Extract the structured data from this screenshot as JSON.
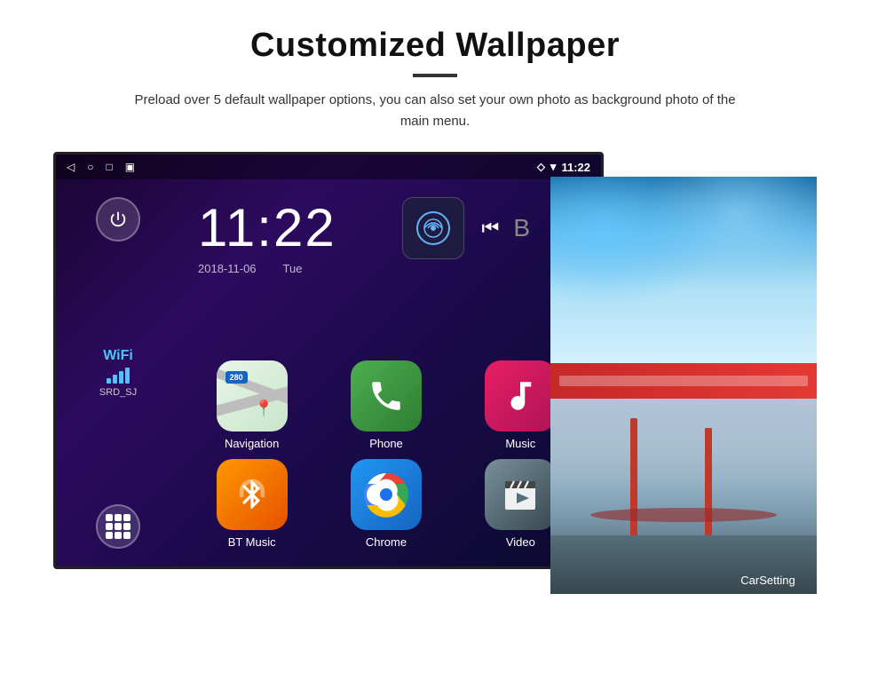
{
  "header": {
    "title": "Customized Wallpaper",
    "subtitle": "Preload over 5 default wallpaper options, you can also set your own photo as background photo of the main menu."
  },
  "status_bar": {
    "time": "11:22",
    "wifi_icon": "▼",
    "location_icon": "📍"
  },
  "clock": {
    "time": "11:22",
    "date": "2018-11-06",
    "day": "Tue"
  },
  "wifi": {
    "label": "WiFi",
    "network": "SRD_SJ"
  },
  "apps": [
    {
      "id": "navigation",
      "label": "Navigation",
      "type": "nav"
    },
    {
      "id": "phone",
      "label": "Phone",
      "type": "phone"
    },
    {
      "id": "music",
      "label": "Music",
      "type": "music"
    },
    {
      "id": "bt-music",
      "label": "BT Music",
      "type": "bt"
    },
    {
      "id": "chrome",
      "label": "Chrome",
      "type": "chrome"
    },
    {
      "id": "video",
      "label": "Video",
      "type": "video"
    }
  ],
  "wallpapers": {
    "car_setting_label": "CarSetting"
  },
  "nav_badge": "280"
}
